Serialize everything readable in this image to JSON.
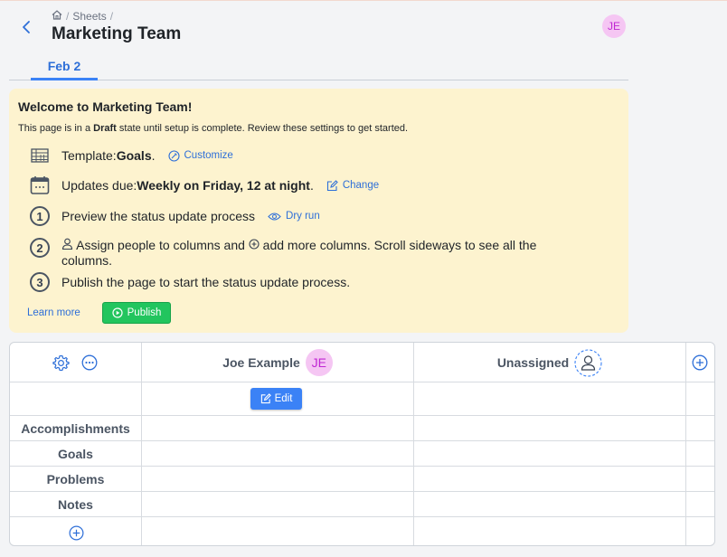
{
  "breadcrumb": {
    "sheets": "Sheets",
    "sep": "/",
    "trail_sep": "/"
  },
  "page": {
    "title": "Marketing Team"
  },
  "user": {
    "initials": "JE"
  },
  "tabs": [
    {
      "label": "Feb 2",
      "active": true
    }
  ],
  "draft": {
    "title": "Welcome to Marketing Team!",
    "desc_pre": "This page is in a ",
    "desc_bold": "Draft",
    "desc_post": " state until setup is complete. Review these settings to get started.",
    "template_pre": "Template: ",
    "template_name": "Goals",
    "template_post": ".",
    "customize": "Customize",
    "updates_pre": "Updates due: ",
    "updates_value": "Weekly on Friday, 12 at night",
    "updates_post": ".",
    "change": "Change",
    "step1_num": "1",
    "step1_text": "Preview the status update process",
    "dry_run": "Dry run",
    "step2_num": "2",
    "step2_a": " Assign people to columns and ",
    "step2_b": " add more columns. Scroll sideways to see all the",
    "step2_c": "columns.",
    "step3_num": "3",
    "step3_text": "Publish the page to start the status update process.",
    "learn_more": "Learn more",
    "publish": "Publish"
  },
  "grid": {
    "columns": [
      {
        "name": "Joe Example",
        "initials": "JE"
      },
      {
        "name": "Unassigned"
      }
    ],
    "edit_label": "Edit",
    "rows": [
      "Accomplishments",
      "Goals",
      "Problems",
      "Notes"
    ]
  },
  "colors": {
    "accent": "#3b82f6",
    "publish": "#22c55e",
    "draft_bg": "#fdf3cf",
    "avatar_bg": "#f5c6f3",
    "avatar_fg": "#c026d3"
  }
}
